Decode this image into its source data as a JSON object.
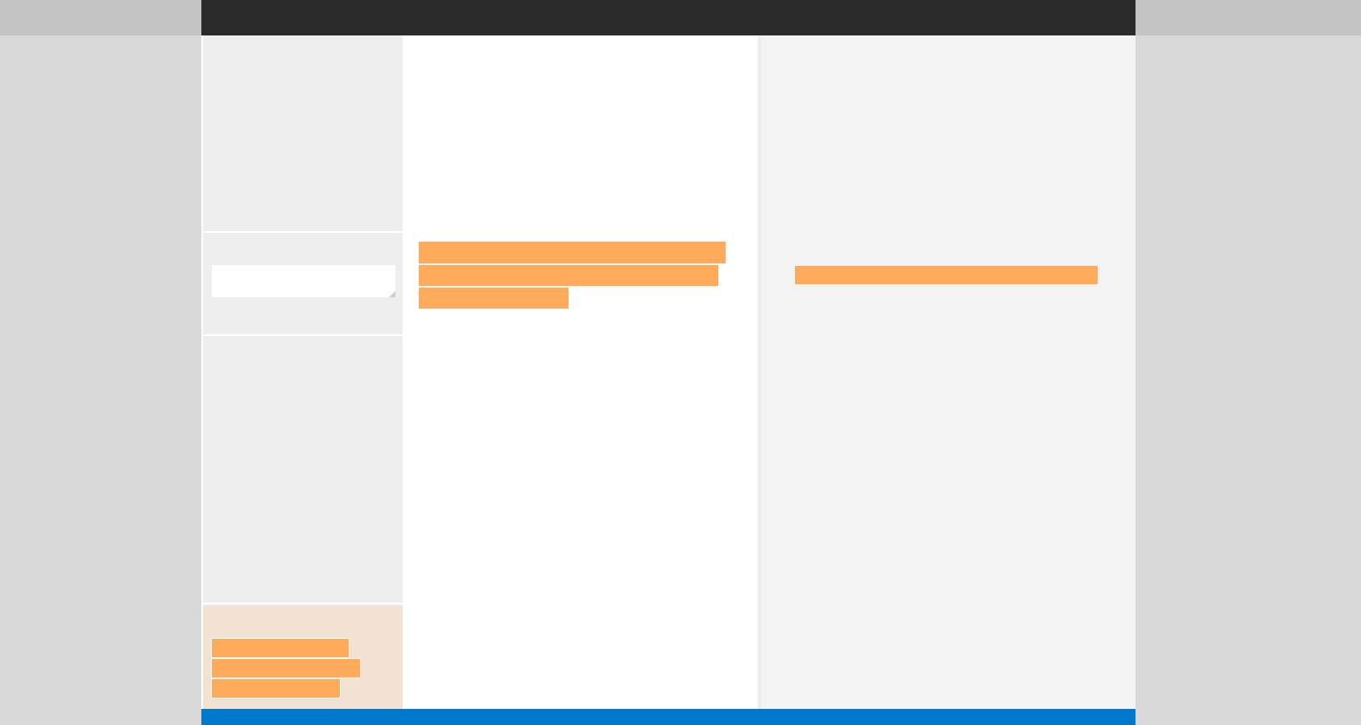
{
  "search": {
    "value": "",
    "placeholder": ""
  },
  "sidebar": {
    "promo_lines": [
      "",
      "",
      ""
    ]
  },
  "main": {
    "lines": [
      "",
      "",
      ""
    ]
  },
  "right_panel": {
    "line": ""
  },
  "colors": {
    "header": "#2b2b2b",
    "footer": "#0079cc",
    "redaction": "#ffab5b",
    "promo_bg": "#f2e2d4",
    "sidebar_bg": "#eeeeee",
    "right_panel_bg": "#f3f3f3"
  }
}
